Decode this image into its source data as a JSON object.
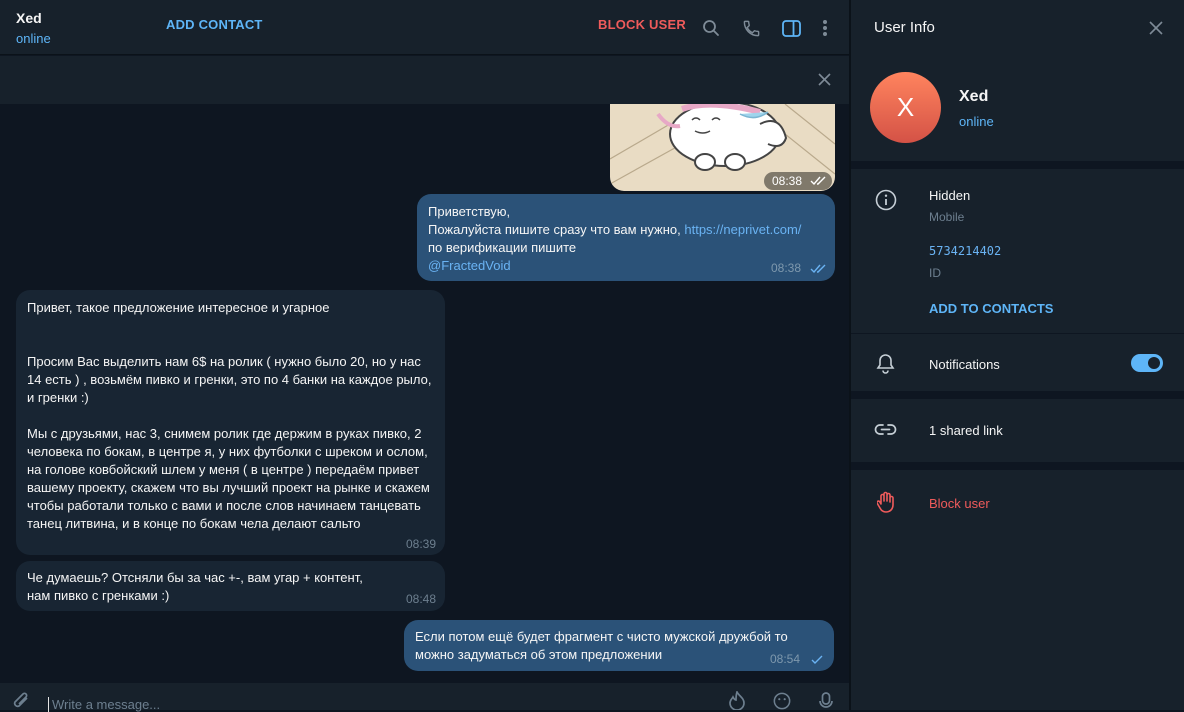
{
  "chat": {
    "name": "Xed",
    "status": "online",
    "composer_placeholder": "Write a message..."
  },
  "action_bar": {
    "add_contact": "ADD CONTACT",
    "block_user": "BLOCK USER"
  },
  "messages": [
    {
      "time": "08:38",
      "type": "sticker"
    },
    {
      "direction": "out",
      "line1": "Приветствую,",
      "line2_prefix": "Пожалуйста пишите сразу что вам нужно, ",
      "line2_link": "https://neprivet.com/",
      "line3": "по верификации пишите",
      "mention": "@FractedVoid",
      "time": "08:38"
    },
    {
      "direction": "in",
      "text": "Привет, такое предложение интересное и угарное\n\n\nПросим Вас выделить нам 6$ на ролик ( нужно было 20, но у нас 14 есть ) , возьмём пивко и гренки, это по 4 банки на каждое рыло, и гренки :)\n\nМы с друзьями, нас 3, снимем ролик где держим в руках пивко, 2 человека по бокам, в центре я, у них футболки с шреком и ослом, на голове ковбойский шлем у меня ( в центре ) передаём привет вашему проекту, скажем что вы лучший проект на рынке и скажем чтобы работали только с вами и после слов начинаем танцевать танец литвина, и в конце по бокам чела делают сальто",
      "time": "08:39"
    },
    {
      "direction": "in",
      "text": "Че думаешь? Отсняли бы за час +-, вам угар + контент, нам пивко с гренками :)",
      "time": "08:48"
    },
    {
      "direction": "out",
      "text": "Если потом ещё будет фрагмент с чисто мужской дружбой то можно задуматься об этом предложении",
      "time": "08:54"
    }
  ],
  "panel": {
    "title": "User Info",
    "avatar_letter": "X",
    "name": "Xed",
    "status": "online",
    "phone_value": "Hidden",
    "phone_label": "Mobile",
    "id_value": "5734214402",
    "id_label": "ID",
    "add_to_contacts": "ADD TO CONTACTS",
    "notifications_label": "Notifications",
    "notifications_on": true,
    "shared_links": "1 shared link",
    "block_user": "Block user"
  },
  "colors": {
    "accent": "#5eb5f7",
    "danger": "#ef5b5b",
    "bubble_out": "#2b5278",
    "bubble_in": "#182533",
    "background": "#0e1621",
    "panel": "#17212b"
  },
  "icons": [
    "search-icon",
    "phone-icon",
    "sidebar-toggle-icon",
    "more-vertical-icon",
    "close-icon",
    "info-icon",
    "bell-icon",
    "link-icon",
    "hand-stop-icon",
    "attach-icon",
    "sticker-icon",
    "emoji-icon",
    "microphone-icon",
    "double-check-icon",
    "single-check-icon"
  ]
}
